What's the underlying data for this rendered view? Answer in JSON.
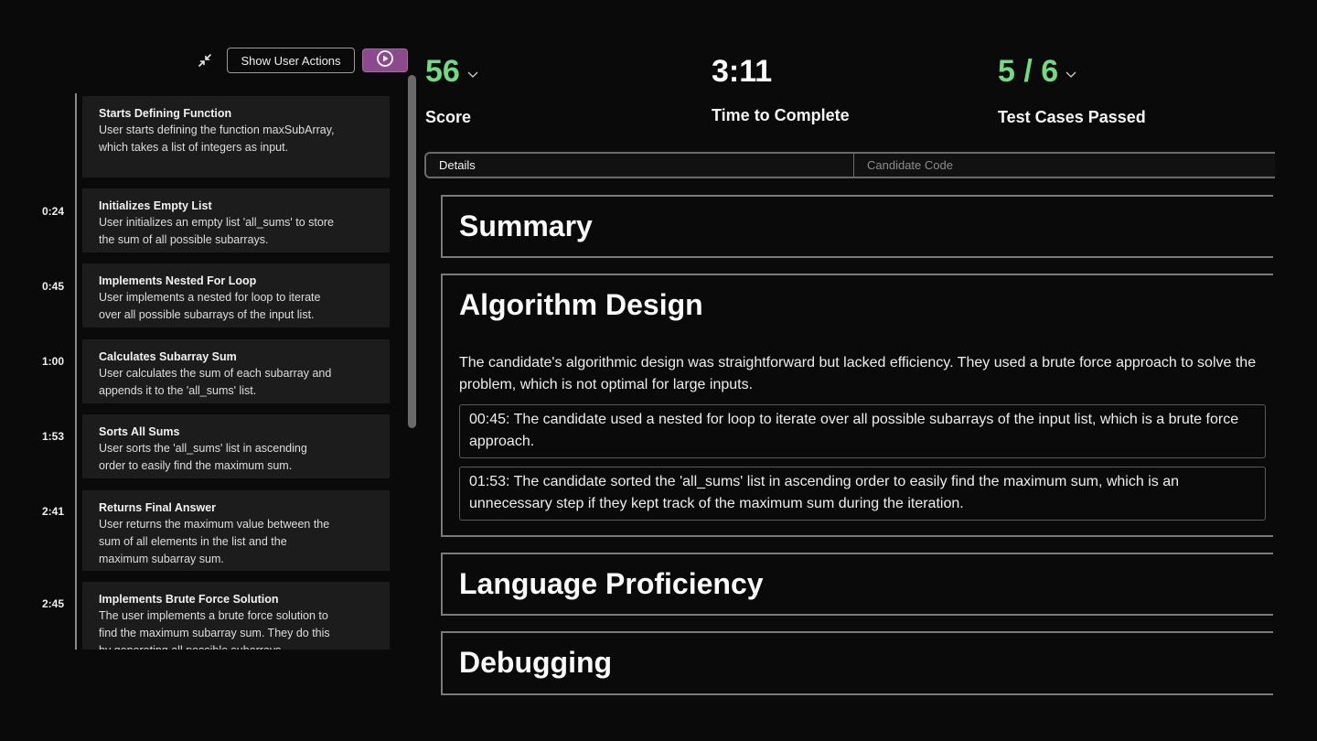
{
  "toolbar": {
    "collapse_icon": "collapse-arrows-icon",
    "show_user_actions_label": "Show User Actions",
    "play_icon": "play-circle-icon",
    "play_color": "#8a4a8c"
  },
  "timeline": {
    "events": [
      {
        "time": "",
        "title": "Starts Defining Function",
        "description": "User starts defining the function maxSubArray, which takes a list of integers as input."
      },
      {
        "time": "0:24",
        "title": "Initializes Empty List",
        "description": "User initializes an empty list 'all_sums' to store the sum of all possible subarrays."
      },
      {
        "time": "0:45",
        "title": "Implements Nested For Loop",
        "description": "User implements a nested for loop to iterate over all possible subarrays of the input list."
      },
      {
        "time": "1:00",
        "title": "Calculates Subarray Sum",
        "description": "User calculates the sum of each subarray and appends it to the 'all_sums' list."
      },
      {
        "time": "1:53",
        "title": "Sorts All Sums",
        "description": "User sorts the 'all_sums' list in ascending order to easily find the maximum sum."
      },
      {
        "time": "2:41",
        "title": "Returns Final Answer",
        "description": "User returns the maximum value between the sum of all elements in the list and the maximum subarray sum."
      },
      {
        "time": "2:45",
        "title": "Implements Brute Force Solution",
        "description": "The user implements a brute force solution to find the maximum subarray sum. They do this by generating all possible subarrays"
      }
    ]
  },
  "stats": {
    "score": {
      "value": "56",
      "label": "Score",
      "color": "#6fdb84"
    },
    "time": {
      "value": "3:11",
      "label": "Time to Complete"
    },
    "tests": {
      "value": "5 / 6",
      "label": "Test Cases Passed",
      "color": "#6fdb84"
    }
  },
  "tabs": [
    {
      "label": "Details",
      "active": true
    },
    {
      "label": "Candidate Code",
      "active": false
    }
  ],
  "sections": {
    "summary": {
      "title": "Summary"
    },
    "algorithm_design": {
      "title": "Algorithm Design",
      "body": "The candidate's algorithmic design was straightforward but lacked efficiency. They used a brute force approach to solve the problem, which is not optimal for large inputs.",
      "evidence": [
        "00:45: The candidate used a nested for loop to iterate over all possible subarrays of the input list, which is a brute force approach.",
        "01:53: The candidate sorted the 'all_sums' list in ascending order to easily find the maximum sum, which is an unnecessary step if they kept track of the maximum sum during the iteration."
      ]
    },
    "language_proficiency": {
      "title": "Language Proficiency"
    },
    "debugging": {
      "title": "Debugging"
    }
  }
}
